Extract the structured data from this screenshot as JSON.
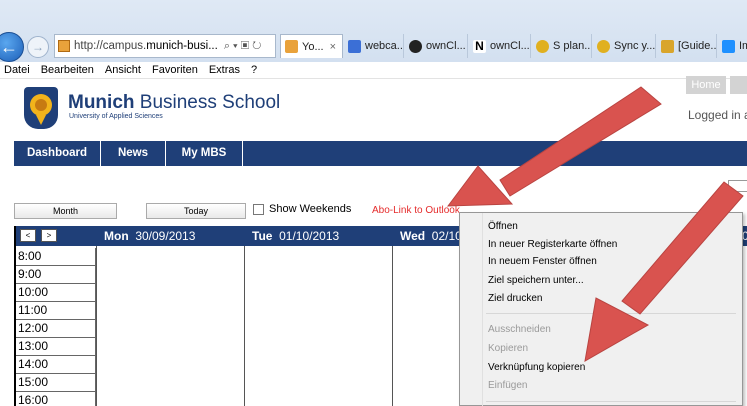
{
  "browser": {
    "url_prefix": "http://campus.",
    "url_domain": "munich-busi...",
    "addr_tools": "⌕ ▾ ▣ ↻",
    "active_tab": "Yo...",
    "tabs": [
      {
        "label": "webca...",
        "color": "#3b6fd6"
      },
      {
        "label": "ownCl...",
        "color": "#222222"
      },
      {
        "label": "ownCl...",
        "color": "#111111"
      },
      {
        "label": "S plan...",
        "color": "#e0b020"
      },
      {
        "label": "Sync y...",
        "color": "#e0b020"
      },
      {
        "label": "[Guide...",
        "color": "#d9a52b"
      },
      {
        "label": "Im",
        "color": "#1e90ff"
      }
    ],
    "tab_icons": {
      "active": "shield-favicon",
      "letter_n": "N"
    }
  },
  "menubar": [
    "Datei",
    "Bearbeiten",
    "Ansicht",
    "Favoriten",
    "Extras",
    "?"
  ],
  "site": {
    "brand_bold": "Munich",
    "brand_rest": " Business School",
    "brand_sub": "University of Applied Sciences",
    "home": "Home",
    "logged": "Logged in a"
  },
  "nav": [
    "Dashboard",
    "News",
    "My MBS"
  ],
  "controls": {
    "month": "Month",
    "today": "Today",
    "weekends": "Show Weekends",
    "abo": "Abo-Link to Outlook"
  },
  "calendar": {
    "prev": "<",
    "next": ">",
    "days": [
      {
        "name": "Mon",
        "date": "30/09/2013"
      },
      {
        "name": "Tue",
        "date": "01/10/2013"
      },
      {
        "name": "Wed",
        "date": "02/10"
      }
    ],
    "extra_col": "0",
    "hours": [
      "8:00",
      "9:00",
      "10:00",
      "11:00",
      "12:00",
      "13:00",
      "14:00",
      "15:00",
      "16:00"
    ]
  },
  "context_menu": {
    "items": [
      {
        "label": "Öffnen",
        "disabled": false
      },
      {
        "label": "In neuer Registerkarte öffnen",
        "disabled": false
      },
      {
        "label": "In neuem Fenster öffnen",
        "disabled": false
      },
      {
        "label": "Ziel speichern unter...",
        "disabled": false
      },
      {
        "label": "Ziel drucken",
        "disabled": false
      },
      {
        "label": "Ausschneiden",
        "disabled": true
      },
      {
        "label": "Kopieren",
        "disabled": true
      },
      {
        "label": "Verknüpfung kopieren",
        "disabled": false
      },
      {
        "label": "Einfügen",
        "disabled": true
      }
    ]
  },
  "colors": {
    "brand": "#1f3f78",
    "abo_link": "#e52b2b",
    "annotation_arrow": "#d9534f"
  }
}
